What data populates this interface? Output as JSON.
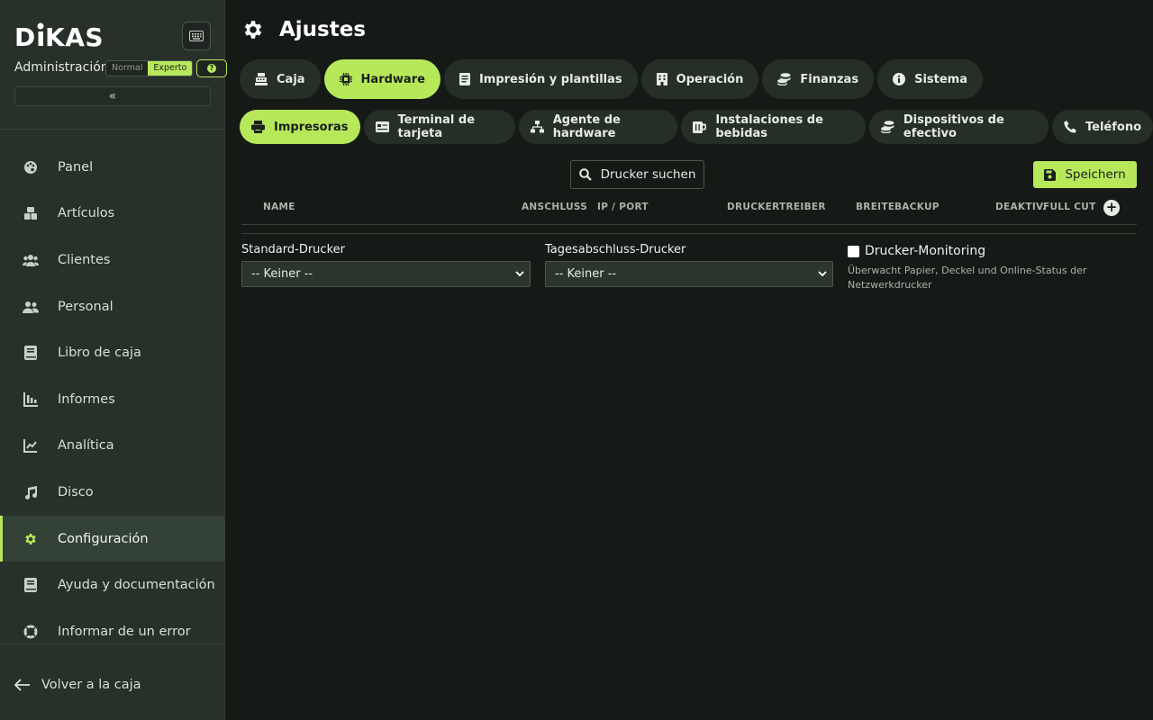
{
  "app": {
    "logo_text": "DKAS",
    "admin_label": "Administración",
    "mode_normal": "Normal",
    "mode_expert": "Experto",
    "collapse_glyph": "«"
  },
  "nav": [
    {
      "label": "Panel",
      "icon": "palette-icon"
    },
    {
      "label": "Artículos",
      "icon": "boxes-icon"
    },
    {
      "label": "Clientes",
      "icon": "users-icon"
    },
    {
      "label": "Personal",
      "icon": "user-group-icon"
    },
    {
      "label": "Libro de caja",
      "icon": "book-icon"
    },
    {
      "label": "Informes",
      "icon": "bar-chart-icon"
    },
    {
      "label": "Analítica",
      "icon": "line-chart-icon"
    },
    {
      "label": "Disco",
      "icon": "music-icon"
    },
    {
      "label": "Configuración",
      "icon": "gear-icon",
      "active": true
    },
    {
      "label": "Ayuda y documentación",
      "icon": "book-icon"
    },
    {
      "label": "Informar de un error",
      "icon": "lifebuoy-icon"
    }
  ],
  "back_link": "Volver a la caja",
  "page": {
    "title": "Ajustes"
  },
  "tabs": [
    {
      "label": "Caja",
      "icon": "register-icon"
    },
    {
      "label": "Hardware",
      "icon": "chip-icon",
      "active": true
    },
    {
      "label": "Impresión y plantillas",
      "icon": "document-icon"
    },
    {
      "label": "Operación",
      "icon": "building-icon"
    },
    {
      "label": "Finanzas",
      "icon": "coins-icon"
    },
    {
      "label": "Sistema",
      "icon": "info-icon"
    }
  ],
  "subtabs": [
    {
      "label": "Impresoras",
      "icon": "printer-icon",
      "active": true
    },
    {
      "label": "Terminal de tarjeta",
      "icon": "card-icon"
    },
    {
      "label": "Agente de hardware",
      "icon": "network-icon"
    },
    {
      "label": "Instalaciones de bebidas",
      "icon": "mug-icon"
    },
    {
      "label": "Dispositivos de efectivo",
      "icon": "coins-icon"
    },
    {
      "label": "Teléfono",
      "icon": "phone-icon"
    }
  ],
  "toolbar": {
    "search_label": "Drucker suchen",
    "save_label": "Speichern"
  },
  "table": {
    "columns": [
      "NAME",
      "ANSCHLUSS",
      "IP / PORT",
      "DRUCKERTREIBER",
      "BREITE",
      "BACKUP",
      "DEAKTIV.",
      "FULL CUT"
    ],
    "add_glyph": "+"
  },
  "settings": {
    "default_printer_label": "Standard-Drucker",
    "default_printer_value": "-- Keiner --",
    "eod_printer_label": "Tagesabschluss-Drucker",
    "eod_printer_value": "-- Keiner --",
    "monitoring_label": "Drucker-Monitoring",
    "monitoring_checked": false,
    "monitoring_desc": "Überwacht Papier, Deckel und Online-Status der Netzwerkdrucker"
  },
  "colors": {
    "accent": "#b6e85a",
    "sidebar_bg": "#273029",
    "main_bg": "#161a17"
  }
}
